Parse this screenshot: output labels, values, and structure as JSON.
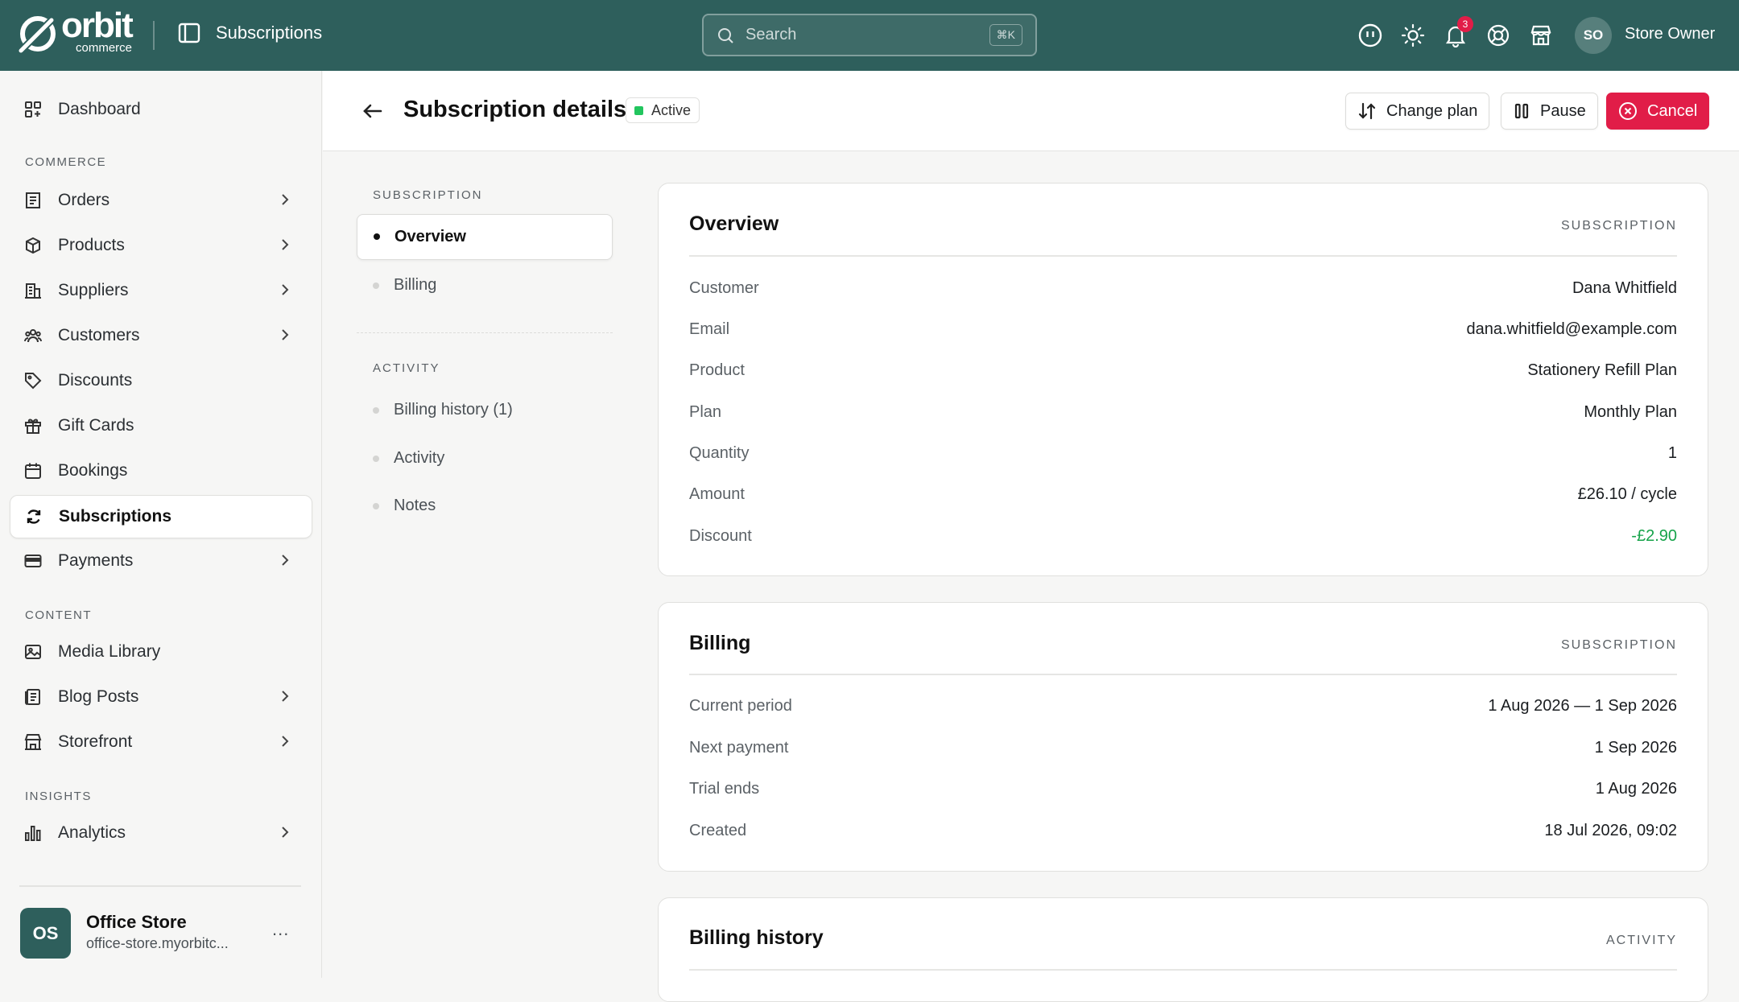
{
  "brand": {
    "word": "orbit",
    "sub": "commerce"
  },
  "topbar": {
    "page_label": "Subscriptions",
    "search_placeholder": "Search",
    "search_shortcut": "⌘K",
    "notification_count": "3",
    "user_initials": "SO",
    "user_name": "Store Owner"
  },
  "sidebar": {
    "dashboard": "Dashboard",
    "sections": {
      "commerce": "COMMERCE",
      "content": "CONTENT",
      "insights": "INSIGHTS"
    },
    "items": {
      "orders": "Orders",
      "products": "Products",
      "suppliers": "Suppliers",
      "customers": "Customers",
      "discounts": "Discounts",
      "gift_cards": "Gift Cards",
      "bookings": "Bookings",
      "subscriptions": "Subscriptions",
      "payments": "Payments",
      "media_library": "Media Library",
      "blog_posts": "Blog Posts",
      "storefront": "Storefront",
      "analytics": "Analytics"
    },
    "store": {
      "initials": "OS",
      "name": "Office Store",
      "url": "office-store.myorbitc...",
      "more": "..."
    }
  },
  "header": {
    "title": "Subscription details",
    "status": "Active",
    "change_plan": "Change plan",
    "pause": "Pause",
    "cancel": "Cancel"
  },
  "inner_nav": {
    "subscription_heading": "SUBSCRIPTION",
    "overview": "Overview",
    "billing": "Billing",
    "activity_heading": "ACTIVITY",
    "billing_history": "Billing history (1)",
    "activity": "Activity",
    "notes": "Notes"
  },
  "overview": {
    "title": "Overview",
    "tag": "SUBSCRIPTION",
    "rows": [
      {
        "label": "Customer",
        "value": "Dana Whitfield"
      },
      {
        "label": "Email",
        "value": "dana.whitfield@example.com"
      },
      {
        "label": "Product",
        "value": "Stationery Refill Plan"
      },
      {
        "label": "Plan",
        "value": "Monthly Plan"
      },
      {
        "label": "Quantity",
        "value": "1"
      },
      {
        "label": "Amount",
        "value": "£26.10 / cycle"
      },
      {
        "label": "Discount",
        "value": "-£2.90"
      }
    ]
  },
  "billing": {
    "title": "Billing",
    "tag": "SUBSCRIPTION",
    "rows": [
      {
        "label": "Current period",
        "value": "1 Aug 2026 — 1 Sep 2026"
      },
      {
        "label": "Next payment",
        "value": "1 Sep 2026"
      },
      {
        "label": "Trial ends",
        "value": "1 Aug 2026"
      },
      {
        "label": "Created",
        "value": "18 Jul 2026, 09:02"
      }
    ]
  },
  "billing_history": {
    "title": "Billing history",
    "tag": "ACTIVITY"
  },
  "colors": {
    "topbar": "#2e5f5c",
    "cancel": "#e11d48",
    "active_status": "#22c55e",
    "discount": "#16a34a"
  }
}
